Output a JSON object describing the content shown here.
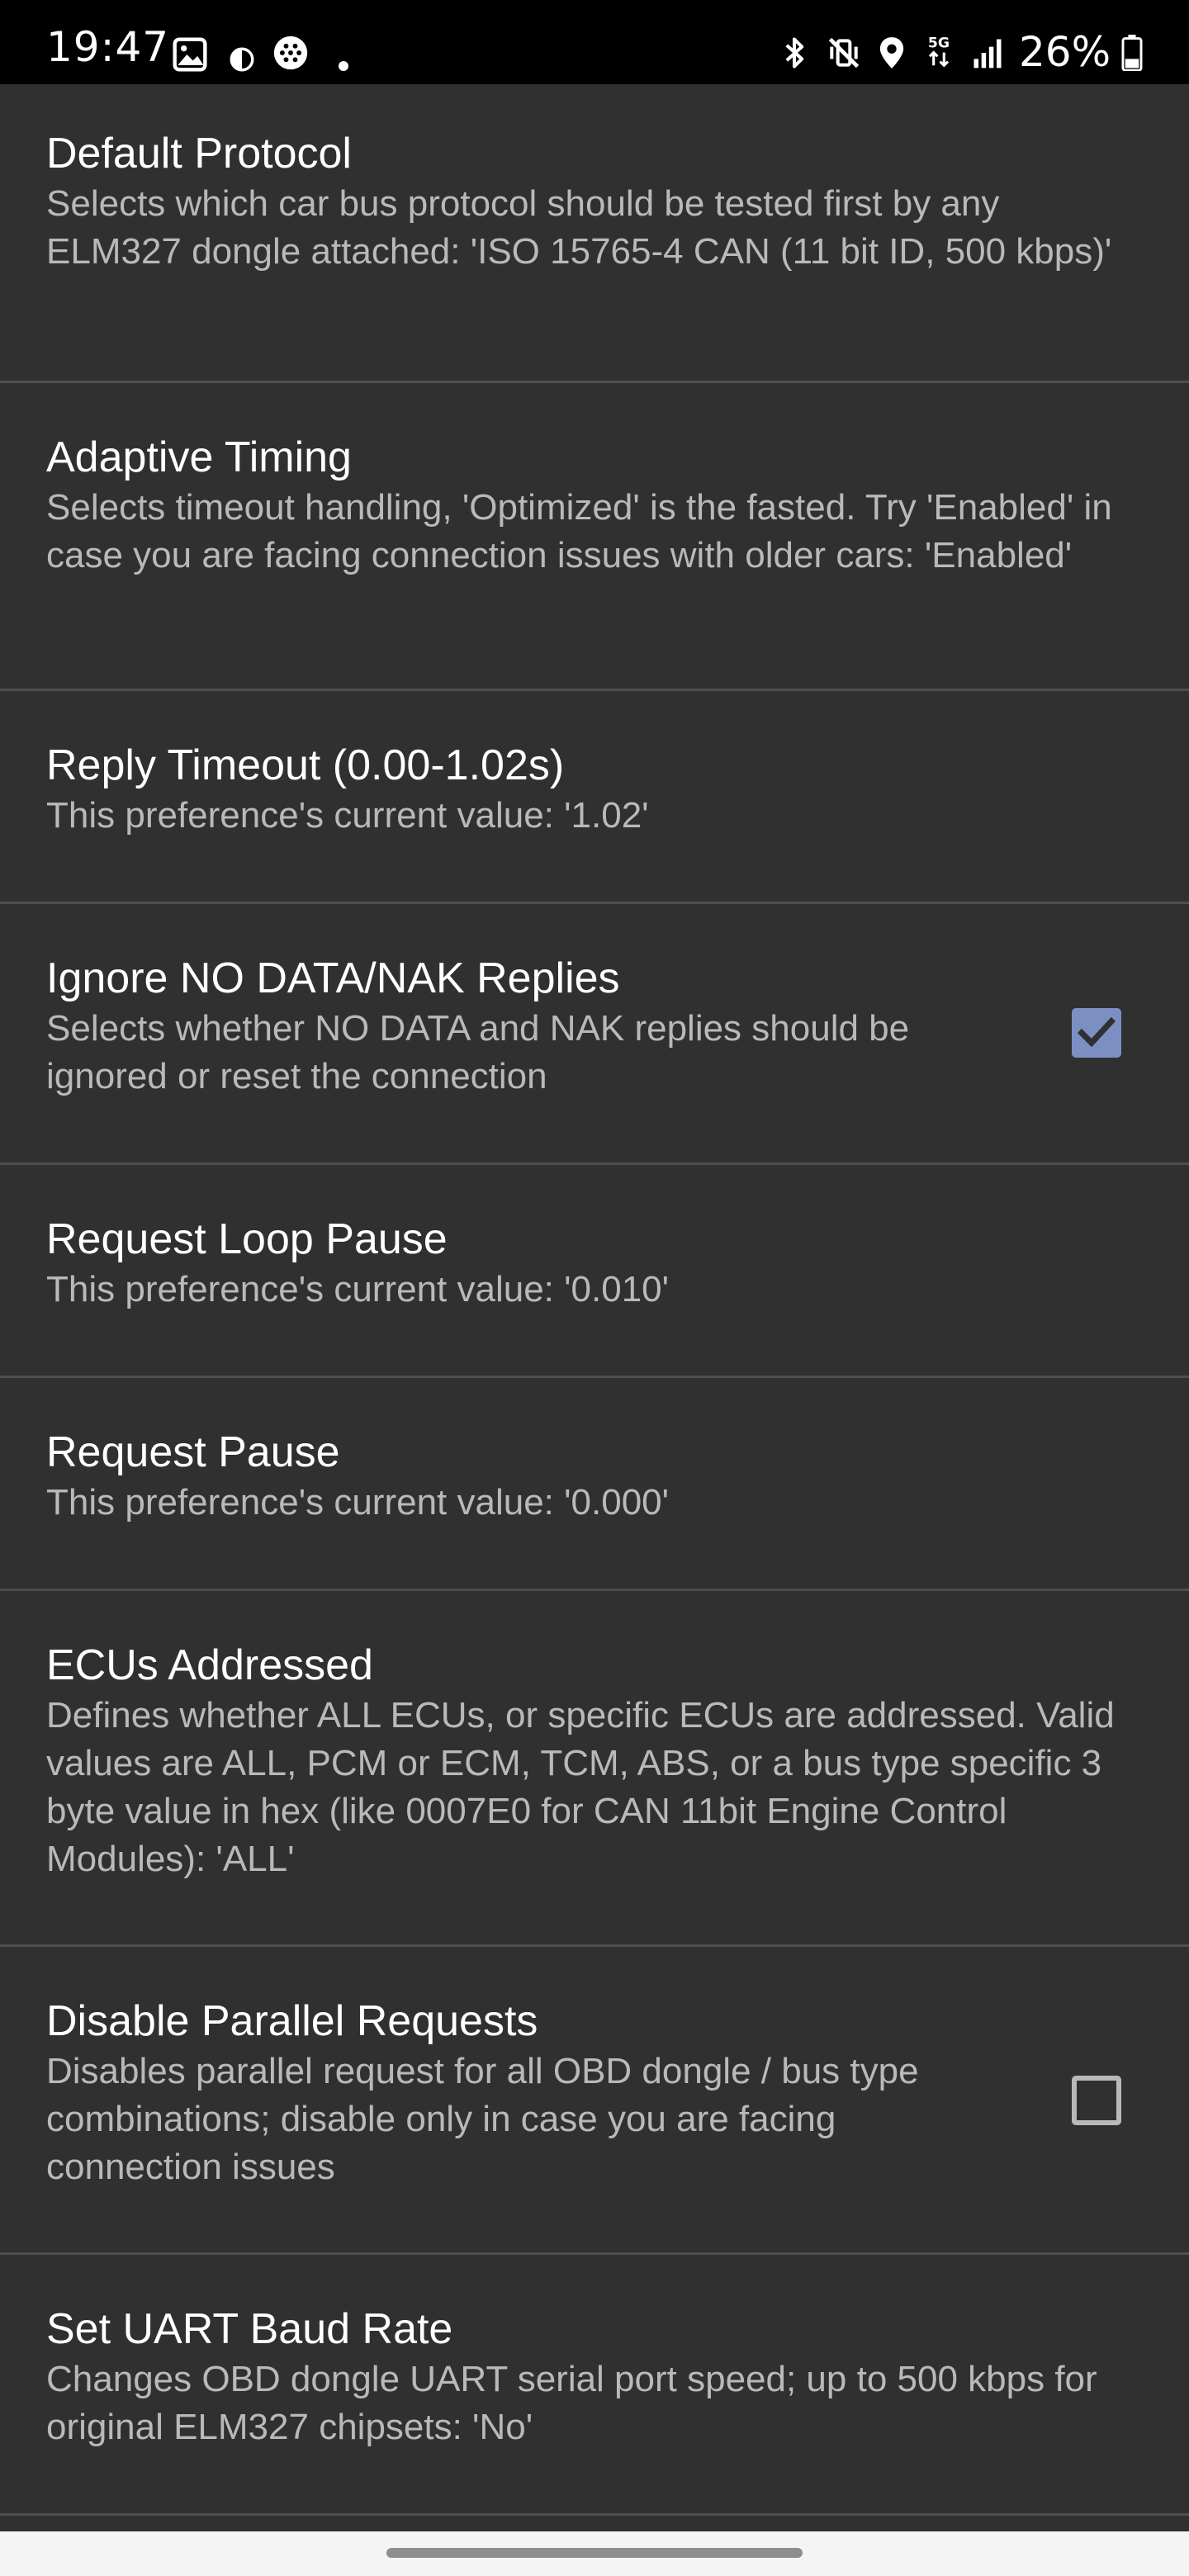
{
  "status_bar": {
    "time": "19:47",
    "battery_percent": "26%",
    "network_badge": "5G",
    "left_icons": [
      "gallery-icon",
      "contrast-icon",
      "app-dots-icon",
      "dot-icon"
    ],
    "right_icons": [
      "bluetooth-icon",
      "vibrate-off-icon",
      "location-icon",
      "5g-network-icon",
      "signal-icon",
      "battery-icon"
    ]
  },
  "preferences": [
    {
      "title": "Default Protocol",
      "summary": "Selects which car bus protocol should be tested first by any ELM327 dongle attached: 'ISO 15765-4 CAN (11 bit ID, 500 kbps)'"
    },
    {
      "title": "Adaptive Timing",
      "summary": "Selects timeout handling, 'Optimized' is the fasted. Try 'Enabled' in case you are facing connection issues with older cars: 'Enabled'"
    },
    {
      "title": "Reply Timeout (0.00-1.02s)",
      "summary": "This preference's current value: '1.02'"
    },
    {
      "title": "Ignore NO DATA/NAK Replies",
      "summary": "Selects whether NO DATA and NAK replies should be ignored or reset the connection",
      "checked": true
    },
    {
      "title": "Request Loop Pause",
      "summary": "This preference's current value: '0.010'"
    },
    {
      "title": "Request Pause",
      "summary": "This preference's current value: '0.000'"
    },
    {
      "title": "ECUs Addressed",
      "summary": "Defines whether ALL ECUs, or specific ECUs are addressed. Valid values are ALL, PCM or ECM, TCM, ABS, or a bus type specific 3 byte value in hex (like 0007E0 for CAN 11bit Engine Control Modules): 'ALL'"
    },
    {
      "title": "Disable Parallel Requests",
      "summary": "Disables parallel request for all OBD dongle / bus type combinations; disable only in case you are facing connection issues",
      "checked": false
    },
    {
      "title": "Set UART Baud Rate",
      "summary": "Changes OBD dongle UART serial port speed; up to 500 kbps for original ELM327 chipsets: 'No'"
    }
  ],
  "colors": {
    "background": "#303030",
    "status_bar": "#000000",
    "title_text": "#ffffff",
    "summary_text": "#b9b9b9",
    "divider": "#4e4e4e",
    "checkbox_accent": "#7b8fc3"
  }
}
